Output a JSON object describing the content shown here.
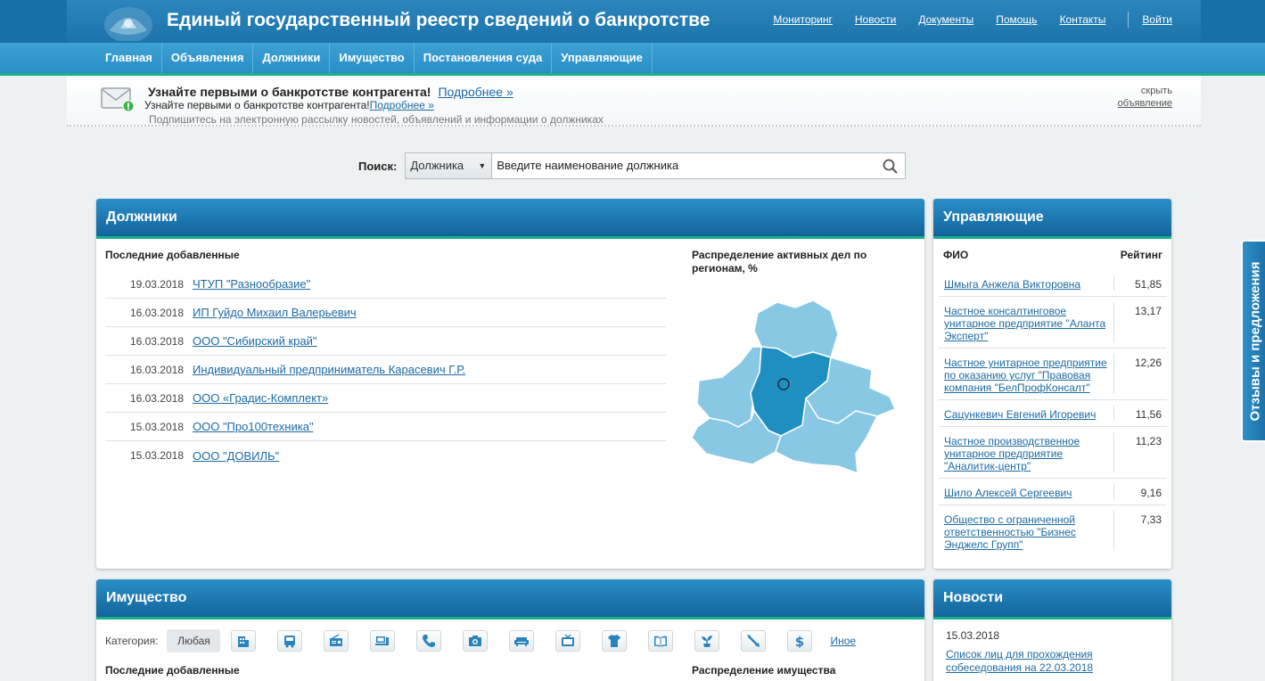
{
  "header": {
    "title": "Единый государственный реестр сведений о банкротстве",
    "links": [
      "Мониторинг",
      "Новости",
      "Документы",
      "Помощь",
      "Контакты"
    ],
    "login": "Войти"
  },
  "nav": [
    "Главная",
    "Объявления",
    "Должники",
    "Имущество",
    "Постановления суда",
    "Управляющие"
  ],
  "banner": {
    "title": "Узнайте первыми о банкротстве контрагента!",
    "more": "Подробнее »",
    "sub_text": "Узнайте первыми о банкротстве контрагента!",
    "sub_more": "Подробнее »",
    "desc": "Подпишитесь на электронную рассылку новостей, объявлений и информации о должниках",
    "hide_line1": "скрыть",
    "hide_line2": "объявление"
  },
  "search": {
    "label": "Поиск:",
    "select_value": "Должника",
    "placeholder": "Введите наименование должника"
  },
  "debtors": {
    "title": "Должники",
    "recent_label": "Последние добавленные",
    "map_title": "Распределение активных дел по регионам, %",
    "rows": [
      {
        "date": "19.03.2018",
        "name": "ЧТУП \"Разнообразие\""
      },
      {
        "date": "16.03.2018",
        "name": "ИП Гуйдо Михаил Валерьевич"
      },
      {
        "date": "16.03.2018",
        "name": "ООО \"Сибирский край\""
      },
      {
        "date": "16.03.2018",
        "name": "Индивидуальный предприниматель Карасевич Г.Р."
      },
      {
        "date": "16.03.2018",
        "name": "ООО «Градис-Комплект»"
      },
      {
        "date": "15.03.2018",
        "name": "ООО \"Про100техника\""
      },
      {
        "date": "15.03.2018",
        "name": "ООО \"ДОВИЛЬ\""
      }
    ]
  },
  "managers": {
    "title": "Управляющие",
    "col_name": "ФИО",
    "col_rating": "Рейтинг",
    "rows": [
      {
        "name": "Шмыга Анжела Викторовна",
        "rating": "51,85"
      },
      {
        "name": "Частное консалтинговое унитарное предприятие \"Аланта Эксперт\"",
        "rating": "13,17"
      },
      {
        "name": "Частное унитарное предприятие по оказанию услуг \"Правовая компания \"БелПрофКонсалт\"",
        "rating": "12,26"
      },
      {
        "name": "Сацункевич Евгений Игоревич",
        "rating": "11,56"
      },
      {
        "name": "Частное производственное унитарное предприятие \"Аналитик-центр\"",
        "rating": "11,23"
      },
      {
        "name": "Шило Алексей Сергеевич",
        "rating": "9,16"
      },
      {
        "name": "Общество с ограниченной ответственностью \"Бизнес Энджелс Групп\"",
        "rating": "7,33"
      }
    ]
  },
  "property": {
    "title": "Имущество",
    "category_label": "Категория:",
    "any_label": "Любая",
    "icons": [
      "building-icon",
      "bus-icon",
      "radio-icon",
      "computer-icon",
      "phone-icon",
      "camera-icon",
      "sofa-icon",
      "tv-icon",
      "tshirt-icon",
      "book-icon",
      "plant-icon",
      "tools-icon",
      "dollar-icon"
    ],
    "other_label": "Иное",
    "recent_label": "Последние добавленные",
    "dist_label": "Распределение имущества"
  },
  "news": {
    "title": "Новости",
    "date": "15.03.2018",
    "link": "Список лиц для прохождения собеседования на 22.03.2018"
  },
  "feedback": "Отзывы и предложения",
  "colors": {
    "header_blue": "#1c73aa",
    "nav_blue": "#2a8ec7",
    "accent_green": "#19b08c",
    "link_blue": "#1d6aa3",
    "map_light": "#88c8e4",
    "map_dark": "#1f8fc1"
  }
}
